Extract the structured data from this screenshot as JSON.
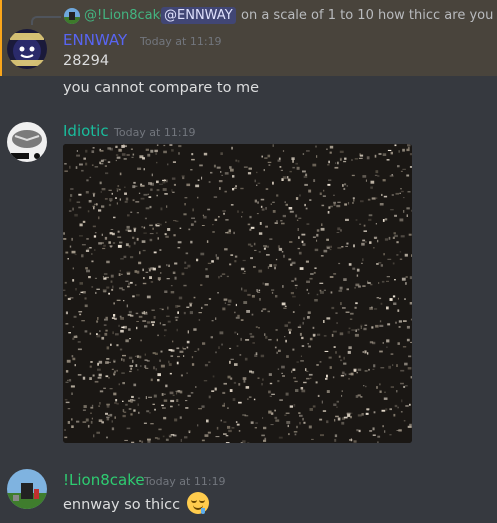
{
  "reply": {
    "author": "@!Lion8cake",
    "mention": "@ENNWAY",
    "text": "on a scale of 1 to 10 how thicc are you"
  },
  "messages": [
    {
      "author": "ENNWAY",
      "author_color": "#5865f2",
      "timestamp": "Today at 11:19",
      "lines": [
        "28294",
        "you cannot compare to me"
      ]
    },
    {
      "author": "Idiotic",
      "author_color": "#1abc9c",
      "timestamp": "Today at 11:19",
      "attachment": "night-photo"
    },
    {
      "author": "!Lion8cake",
      "author_color": "#2ecc71",
      "timestamp": "Today at 11:19",
      "text": "ennway so thicc",
      "emoji": "drooling-face"
    }
  ]
}
